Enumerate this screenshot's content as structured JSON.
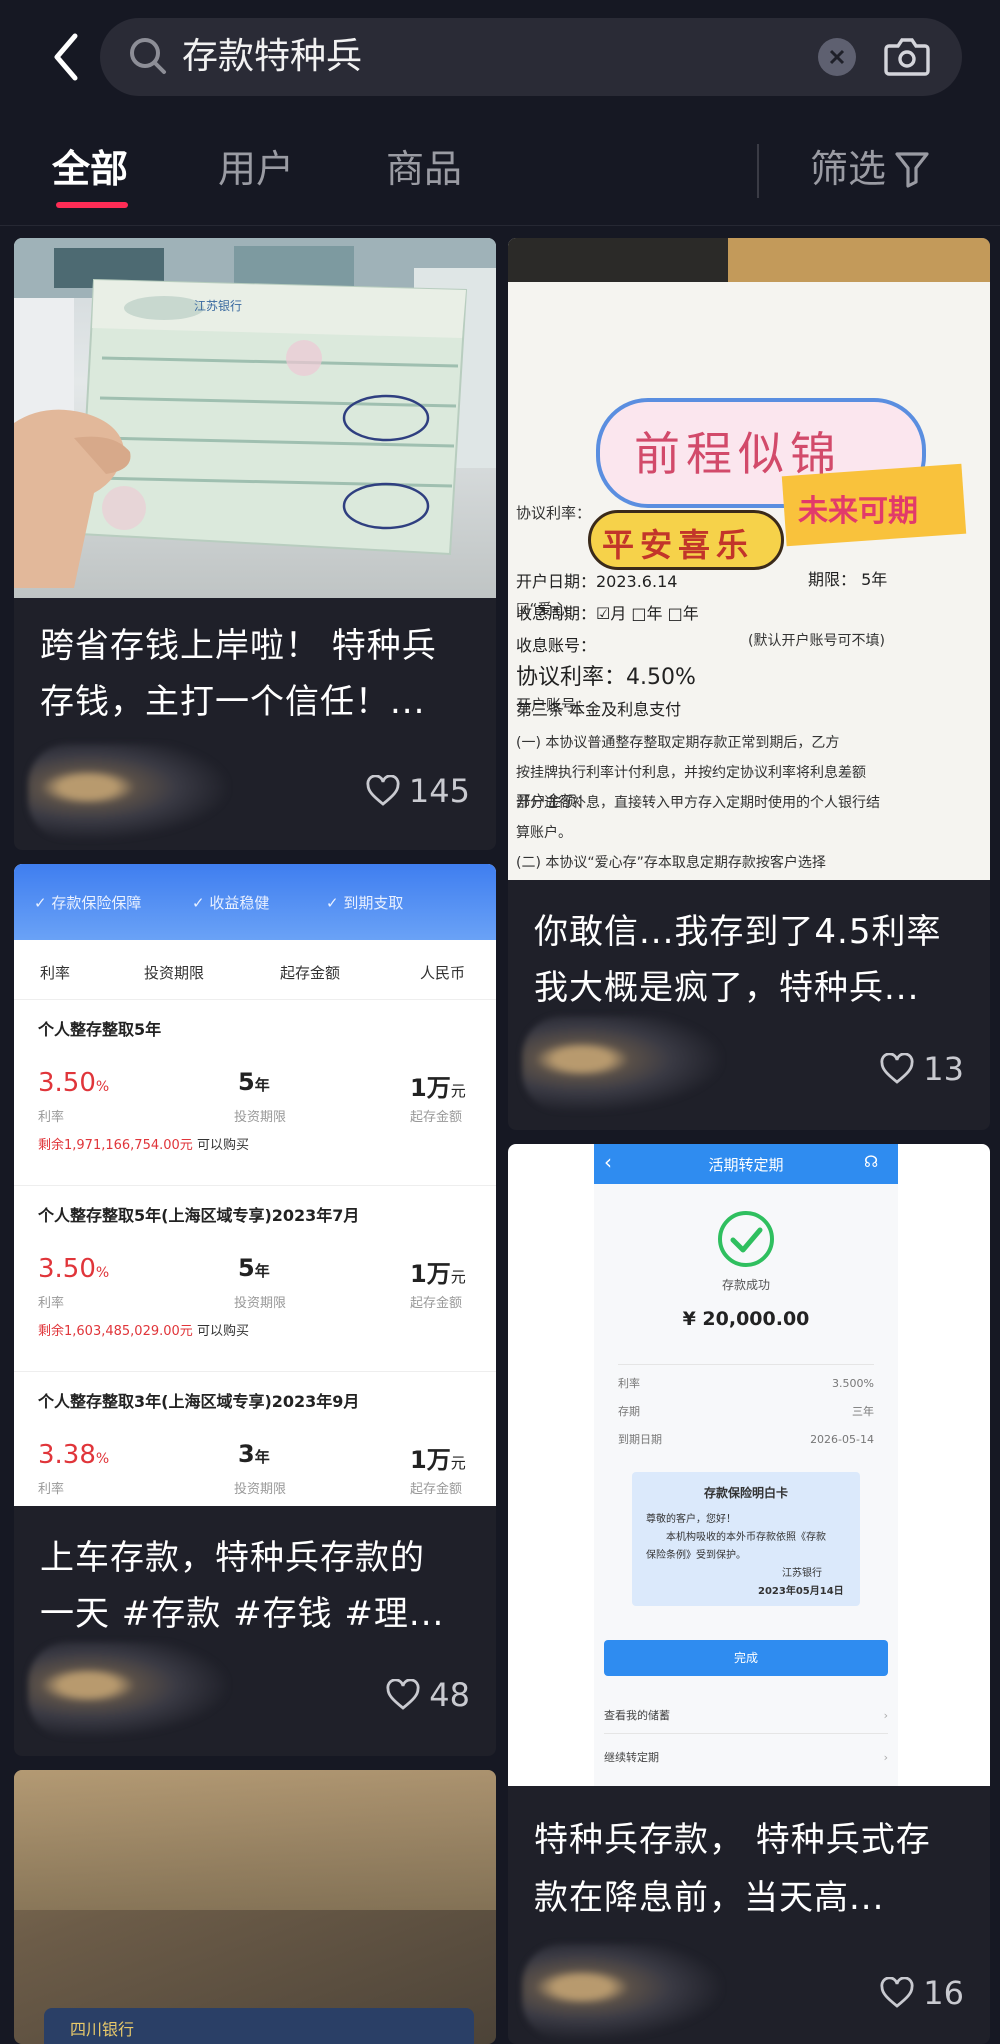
{
  "search": {
    "query": "存款特种兵"
  },
  "tabs": [
    {
      "label": "全部",
      "active": true
    },
    {
      "label": "用户"
    },
    {
      "label": "商品"
    }
  ],
  "filter_label": "筛选",
  "cards": [
    {
      "title_line1": "跨省存钱上岸啦！ 特种兵",
      "title_line2": "存钱，主打一个信任！...",
      "likes": "145"
    },
    {
      "title_line1": "你敢信...我存到了4.5利率",
      "title_line2": "我大概是疯了，特种兵...",
      "likes": "13"
    },
    {
      "title_line1": "上车存款，特种兵存款的",
      "title_line2": "一天 #存款 #存钱 #理...",
      "likes": "48"
    },
    {
      "title_line1": "特种兵存款， 特种兵式存",
      "title_line2": "款在降息前，当天高...",
      "likes": "16"
    }
  ],
  "doc_image": {
    "sticker_main": "前程似锦",
    "sticker_left": "平安喜乐",
    "sticker_right": "未来可期",
    "lines": [
      "协议利率：",
      "☑“爱心",
      "开户账号：",
      "开户金额：",
      "开户日期：2023.6.14",
      "收息周期：☑月  □年  □年",
      "收息账号：",
      "协议利率：4.50%",
      "第三条  本金及利息支付",
      "(一) 本协议普通整存整取定期存款正常到期后，乙方",
      "按挂牌执行利率计付利息，并按约定协议利率将利息差额",
      "部分进行补息，直接转入甲方存入定期时使用的个人银行结",
      "算账户。",
      "(二) 本协议“爱心存”存本取息定期存款按客户选择"
    ],
    "term": "期限： 5年",
    "note": "(默认开户账号可不填)"
  },
  "rate_list": {
    "header_tags": [
      "✓ 存款保险保障",
      "✓ 收益稳健",
      "✓ 到期支取"
    ],
    "columns": [
      "利率",
      "投资期限",
      "起存金额",
      "人民币"
    ],
    "rows": [
      {
        "name": "个人整存整取5年",
        "rate": "3.50",
        "rate_unit": "%",
        "rate_label": "利率",
        "term": "5",
        "term_unit": "年",
        "term_label": "投资期限",
        "min": "1万",
        "min_unit": "元",
        "min_label": "起存金额",
        "remain": "剩余1,971,166,754.00元",
        "buy": "可以购买"
      },
      {
        "name": "个人整存整取5年(上海区域专享)2023年7月",
        "rate": "3.50",
        "rate_unit": "%",
        "rate_label": "利率",
        "term": "5",
        "term_unit": "年",
        "term_label": "投资期限",
        "min": "1万",
        "min_unit": "元",
        "min_label": "起存金额",
        "remain": "剩余1,603,485,029.00元",
        "buy": "可以购买"
      },
      {
        "name": "个人整存整取3年(上海区域专享)2023年9月",
        "rate": "3.38",
        "rate_unit": "%",
        "rate_label": "利率",
        "term": "3",
        "term_unit": "年",
        "term_label": "投资期限",
        "min": "1万",
        "min_unit": "元",
        "min_label": "起存金额"
      }
    ]
  },
  "app_shot": {
    "header": "活期转定期",
    "status": "存款成功",
    "amount": "¥ 20,000.00",
    "details": [
      {
        "k": "利率",
        "v": "3.500%"
      },
      {
        "k": "存期",
        "v": "三年"
      },
      {
        "k": "到期日期",
        "v": "2026-05-14"
      }
    ],
    "card_title": "存款保险明白卡",
    "card_greet": "尊敬的客户，您好！",
    "card_body1": "本机构吸收的本外币存款依照《存款",
    "card_body2": "保险条例》受到保护。",
    "card_bank": "江苏银行",
    "card_date": "2023年05月14日",
    "done": "完成",
    "links": [
      "查看我的储蓄",
      "继续转定期"
    ]
  },
  "bank_logo": "江苏银行",
  "bank2": "四川银行"
}
